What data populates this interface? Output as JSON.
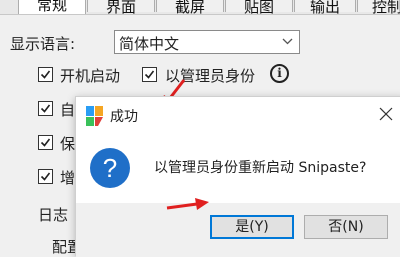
{
  "tabs": [
    {
      "label": "常规",
      "active": true
    },
    {
      "label": "界面",
      "active": false
    },
    {
      "label": "截屏",
      "active": false
    },
    {
      "label": "贴图",
      "active": false
    },
    {
      "label": "输出",
      "active": false
    },
    {
      "label": "控制",
      "active": false
    }
  ],
  "settings": {
    "language_label": "显示语言:",
    "language_value": "简体中文",
    "startup_label": "开机启动",
    "startup_checked": true,
    "admin_label": "以管理员身份",
    "admin_checked": true,
    "row3_partial": "自",
    "row4_partial": "保",
    "row5_partial": "增",
    "log_label": "日志",
    "config_label": "配置"
  },
  "dialog": {
    "title": "成功",
    "message": "以管理员身份重新启动 Snipaste?",
    "yes_label": "是(Y)",
    "no_label": "否(N)",
    "icon": "question-icon",
    "close_icon": "close-icon"
  },
  "annotations": {
    "arrow_color": "#e02020"
  },
  "colors": {
    "accent": "#0078d7",
    "question_icon": "#1f6fc8"
  }
}
